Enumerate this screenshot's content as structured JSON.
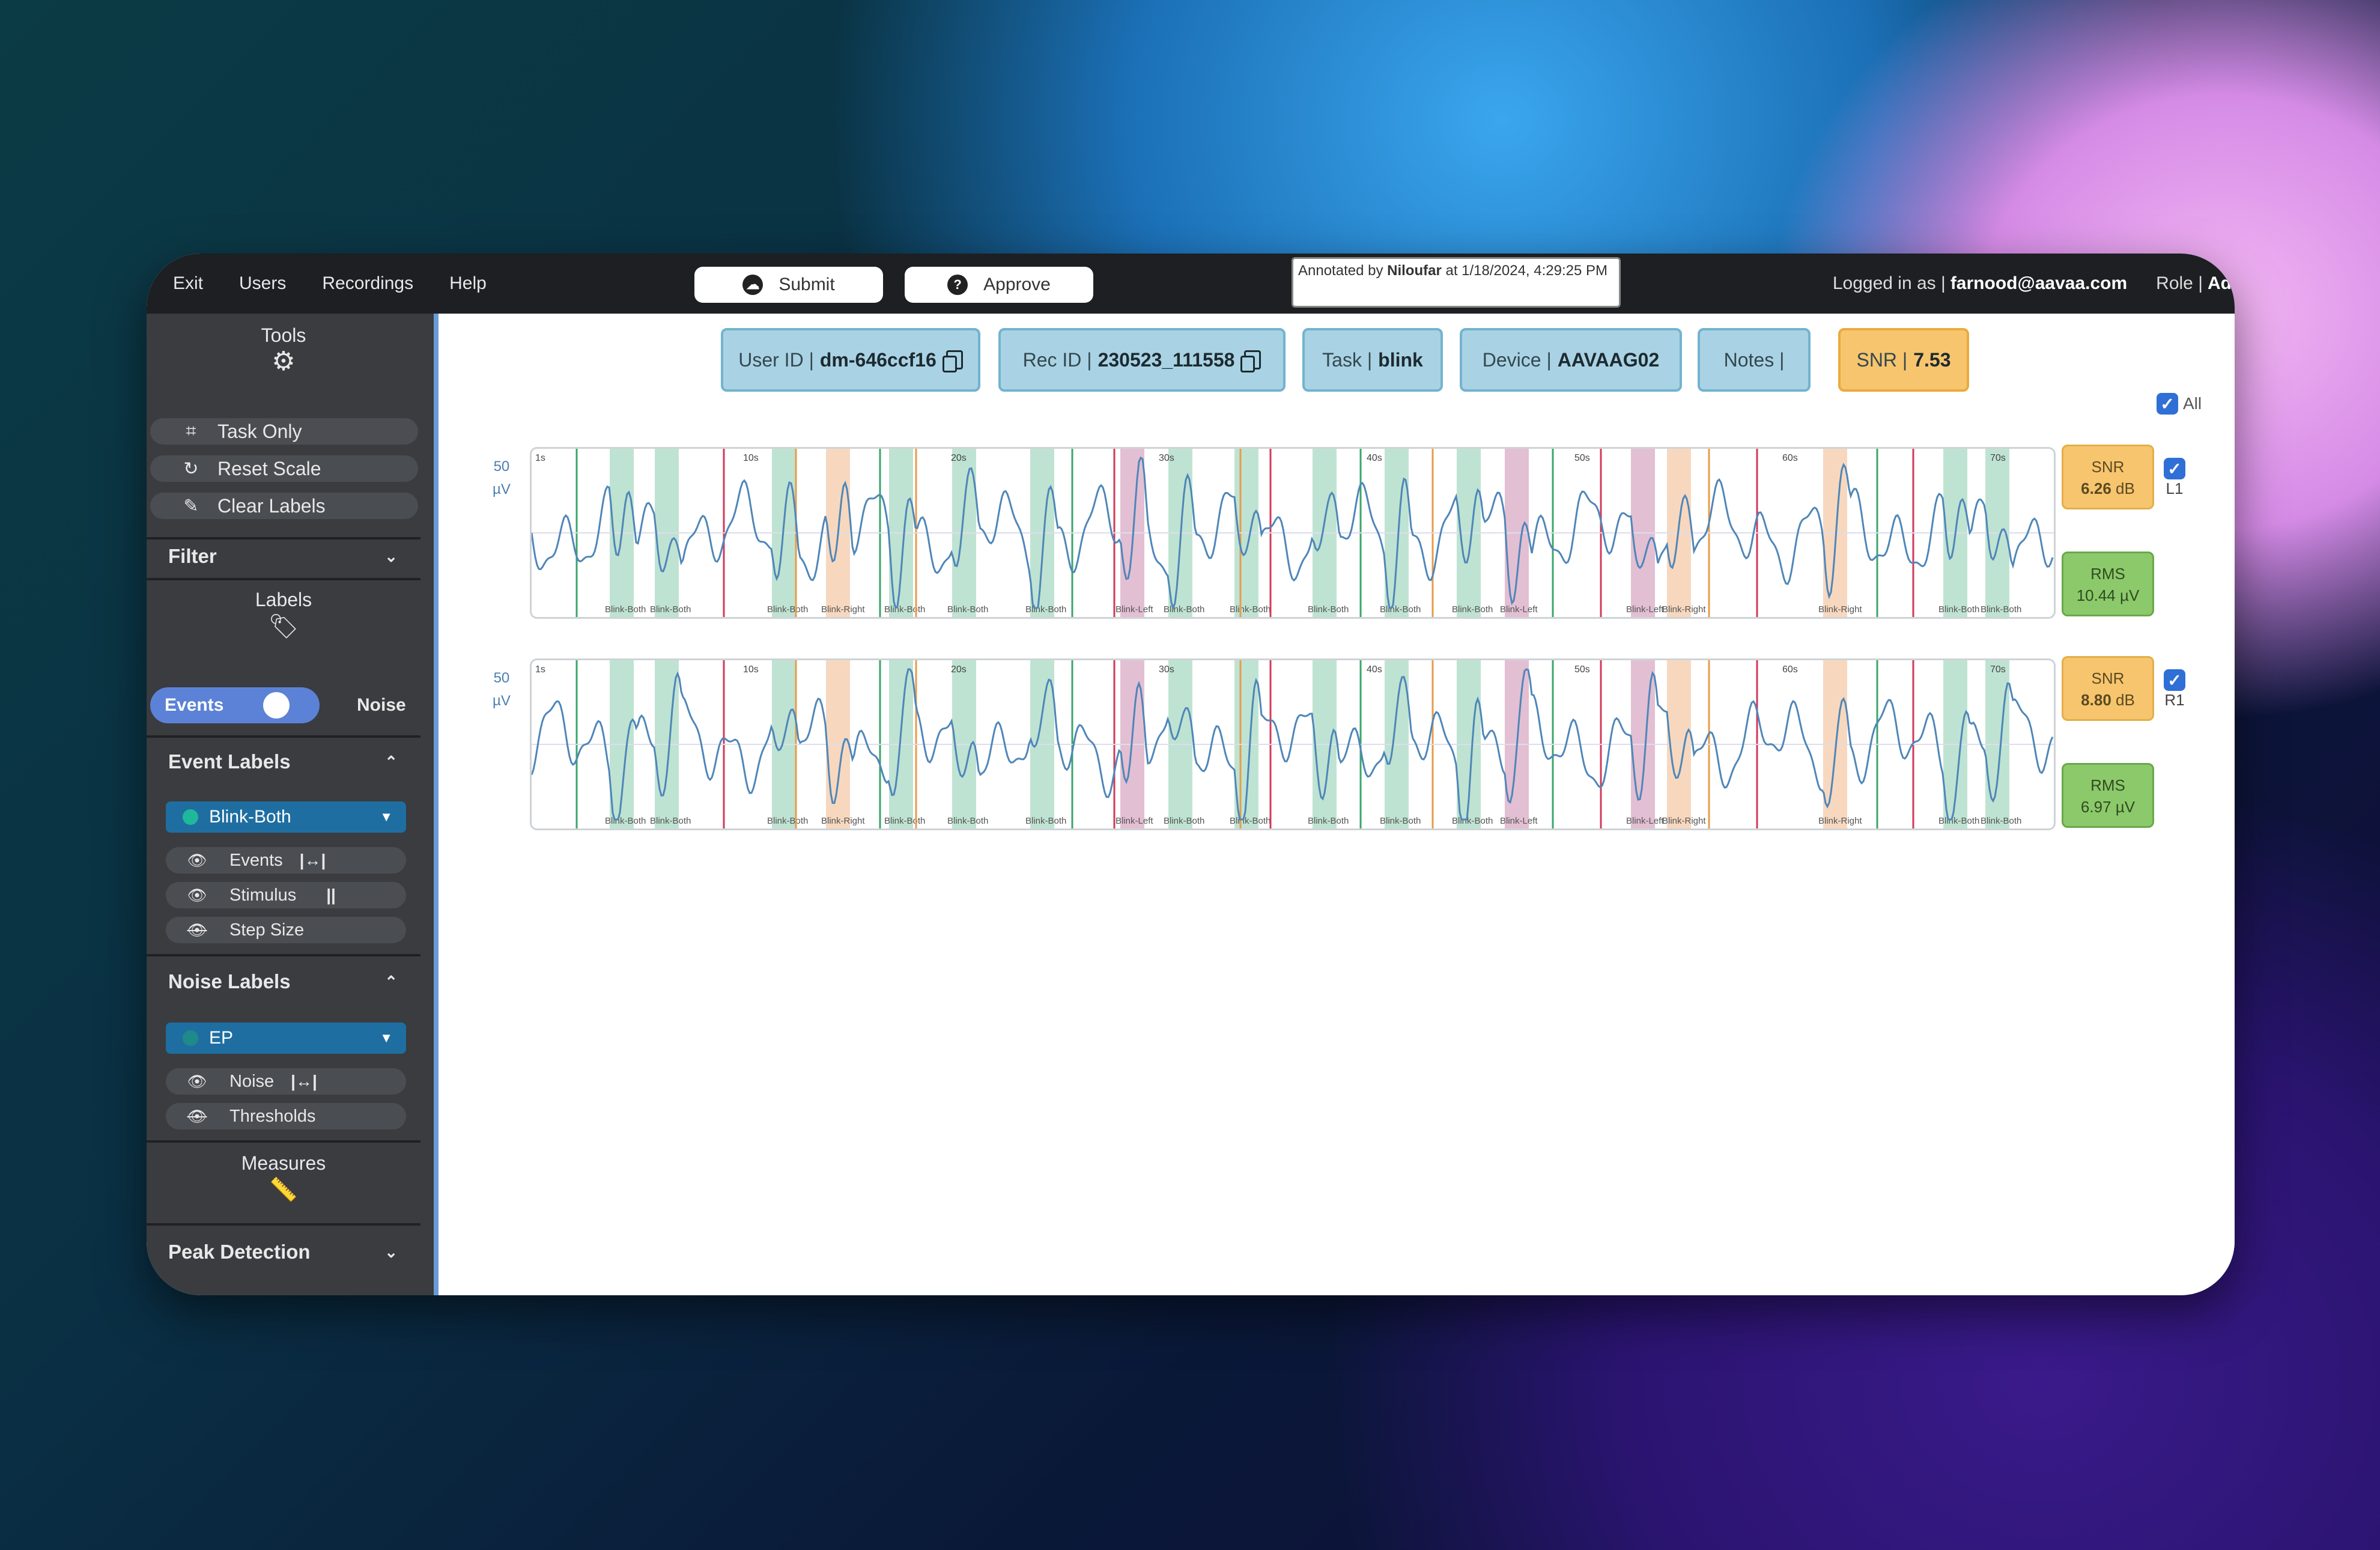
{
  "menu": [
    "Exit",
    "Users",
    "Recordings",
    "Help"
  ],
  "actions": {
    "submit": "Submit",
    "approve": "Approve"
  },
  "annotation": {
    "prefix": "Annotated by ",
    "name": "Niloufar",
    "suffix": " at 1/18/2024, 4:29:25 PM"
  },
  "login": {
    "prefix": "Logged in as |",
    "email": "farnood@aavaa.com",
    "role_prefix": "Role |",
    "role": "Admi"
  },
  "sidebar": {
    "tools_title": "Tools",
    "tool_buttons": [
      "Task Only",
      "Reset Scale",
      "Clear Labels"
    ],
    "filter": "Filter",
    "labels_title": "Labels",
    "toggle_on": "Events",
    "toggle_off": "Noise",
    "event_labels": "Event Labels",
    "event_select": "Blink-Both",
    "event_items": [
      "Events",
      "Stimulus",
      "Step Size"
    ],
    "event_glyphs": [
      "|↔|",
      "||"
    ],
    "noise_labels": "Noise Labels",
    "noise_select": "EP",
    "noise_items": [
      "Noise",
      "Thresholds"
    ],
    "noise_glyph": "|↔|",
    "measures": "Measures",
    "peak_detection": "Peak Detection"
  },
  "info": {
    "user_id_label": "User ID |",
    "user_id": "dm-646ccf16",
    "rec_id_label": "Rec ID |",
    "rec_id": "230523_111558",
    "task_label": "Task |",
    "task": "blink",
    "device_label": "Device |",
    "device": "AAVAAG02",
    "notes_label": "Notes |",
    "snr_label": "SNR |",
    "snr": "7.53"
  },
  "all_label": "All",
  "scale": {
    "value": "50",
    "unit": "µV"
  },
  "time_ticks": [
    "1s",
    "10s",
    "20s",
    "30s",
    "40s",
    "50s",
    "60s",
    "70s"
  ],
  "channels": [
    {
      "name": "L1",
      "snr_label": "SNR",
      "snr": "6.26",
      "snr_unit": "dB",
      "rms_label": "RMS",
      "rms": "10.44 µV"
    },
    {
      "name": "R1",
      "snr_label": "SNR",
      "snr": "8.80",
      "snr_unit": "dB",
      "rms_label": "RMS",
      "rms": "6.97 µV"
    }
  ],
  "event_labels_on_trace": [
    "Blink-Both",
    "Blink-Both",
    "Blink-Both",
    "Blink-Right",
    "Blink-Both",
    "Blink-Both",
    "Blink-Both",
    "Blink-Left",
    "Blink-Both",
    "Blink-Both",
    "Blink-Both",
    "Blink-Both",
    "Blink-Both",
    "Blink-Left",
    "Blink-Left",
    "Blink-Right",
    "Blink-Right",
    "Blink-Both",
    "Blink-Both"
  ],
  "colors": {
    "blink_both": "#bfe3d2",
    "blink_right": "#f7d8bf",
    "blink_left": "#e3bfd3",
    "trace": "#4f86b8"
  }
}
